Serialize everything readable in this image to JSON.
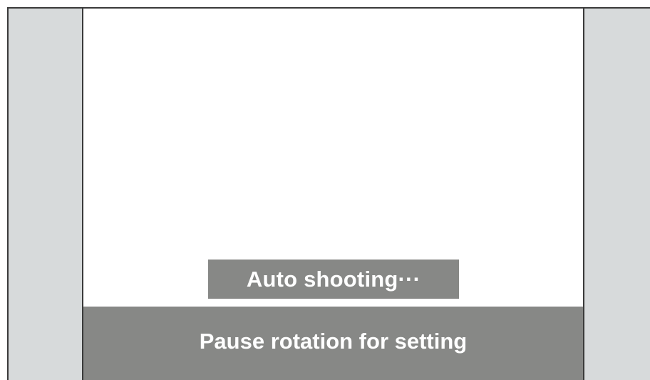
{
  "status": {
    "text": "Auto shooting···"
  },
  "action_bar": {
    "label": "Pause rotation for setting"
  },
  "colors": {
    "side_panel": "#d7dadb",
    "overlay": "#878886",
    "border": "#3a3a3a",
    "text": "#ffffff"
  }
}
